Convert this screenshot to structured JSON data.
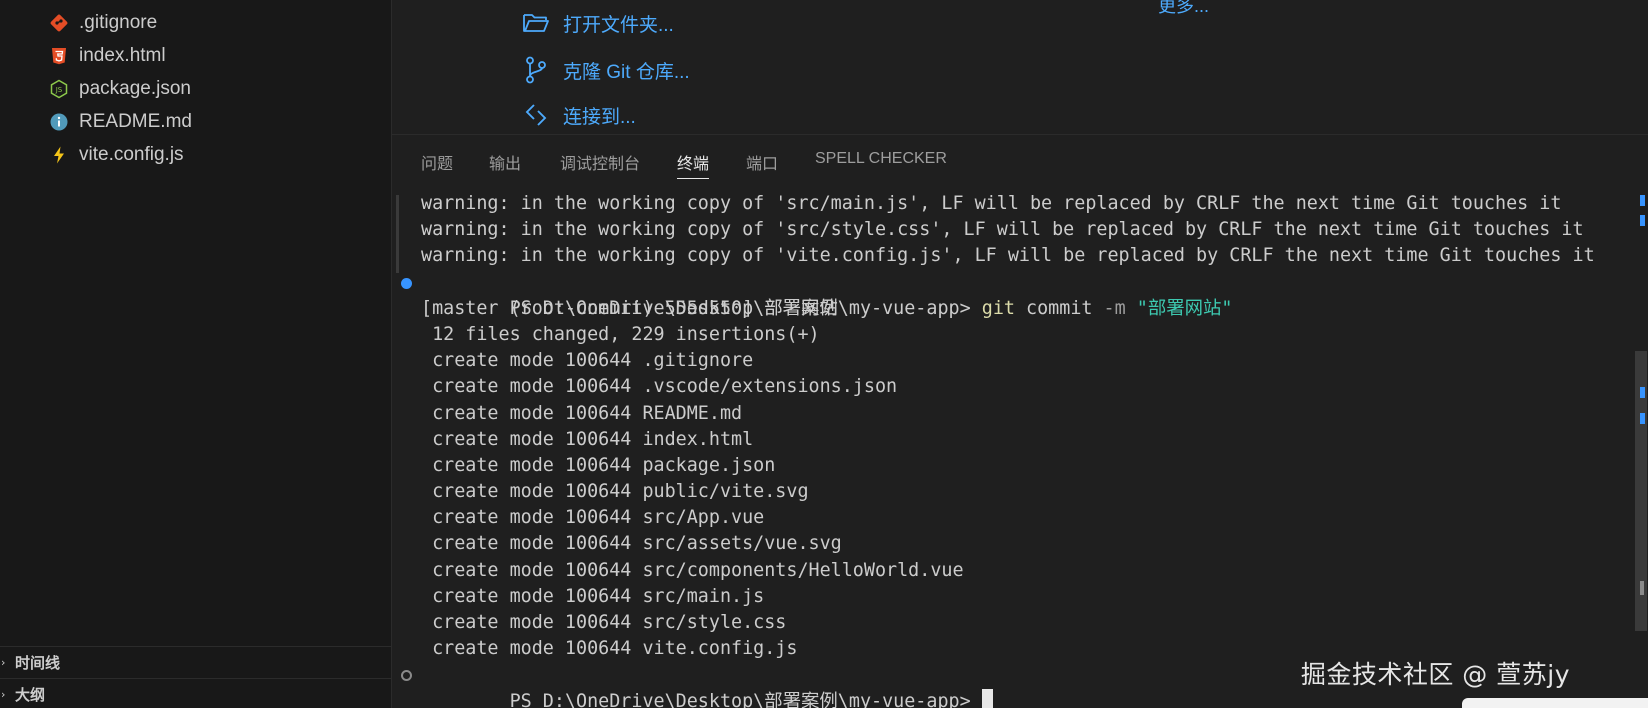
{
  "explorer": {
    "files": [
      {
        "name": ".gitignore",
        "icon": "git-diamond-icon",
        "color": "#e44d26"
      },
      {
        "name": "index.html",
        "icon": "html5-icon",
        "color": "#e44d26"
      },
      {
        "name": "package.json",
        "icon": "nodejs-icon",
        "color": "#8cc84b"
      },
      {
        "name": "README.md",
        "icon": "info-circle-icon",
        "color": "#519aba"
      },
      {
        "name": "vite.config.js",
        "icon": "lightning-icon",
        "color": "#f5c518"
      }
    ],
    "sections": {
      "timeline": "时间线",
      "outline": "大纲"
    }
  },
  "welcome": {
    "more": "更多...",
    "actions": {
      "open_folder": "打开文件夹...",
      "clone_repo": "克隆 Git 仓库...",
      "connect": "连接到..."
    }
  },
  "panel": {
    "tabs": [
      "问题",
      "输出",
      "调试控制台",
      "终端",
      "端口",
      "SPELL CHECKER"
    ],
    "active_tab": "终端"
  },
  "terminal": {
    "warnings": [
      "warning: in the working copy of 'src/main.js', LF will be replaced by CRLF the next time Git touches it",
      "warning: in the working copy of 'src/style.css', LF will be replaced by CRLF the next time Git touches it",
      "warning: in the working copy of 'vite.config.js', LF will be replaced by CRLF the next time Git touches it"
    ],
    "prompt": "PS D:\\OneDrive\\Desktop\\部署案例\\my-vue-app> ",
    "command": {
      "program": "git",
      "sub": " commit",
      "flag": " -m",
      "arg": " \"部署网站\""
    },
    "commit_result": "[master (root-commit) 555d550] 部署网站",
    "summary": " 12 files changed, 229 insertions(+)",
    "create_lines": [
      " create mode 100644 .gitignore",
      " create mode 100644 .vscode/extensions.json",
      " create mode 100644 README.md",
      " create mode 100644 index.html",
      " create mode 100644 package.json",
      " create mode 100644 public/vite.svg",
      " create mode 100644 src/App.vue",
      " create mode 100644 src/assets/vue.svg",
      " create mode 100644 src/components/HelloWorld.vue",
      " create mode 100644 src/main.js",
      " create mode 100644 src/style.css",
      " create mode 100644 vite.config.js"
    ],
    "final_prompt": "PS D:\\OneDrive\\Desktop\\部署案例\\my-vue-app> "
  },
  "watermark": "掘金技术社区 @ 萱苏jy",
  "colors": {
    "accent": "#4daafc",
    "success_dot": "#3794ff",
    "git_cmd": "#dcdcaa",
    "string": "#3dc9b0"
  }
}
